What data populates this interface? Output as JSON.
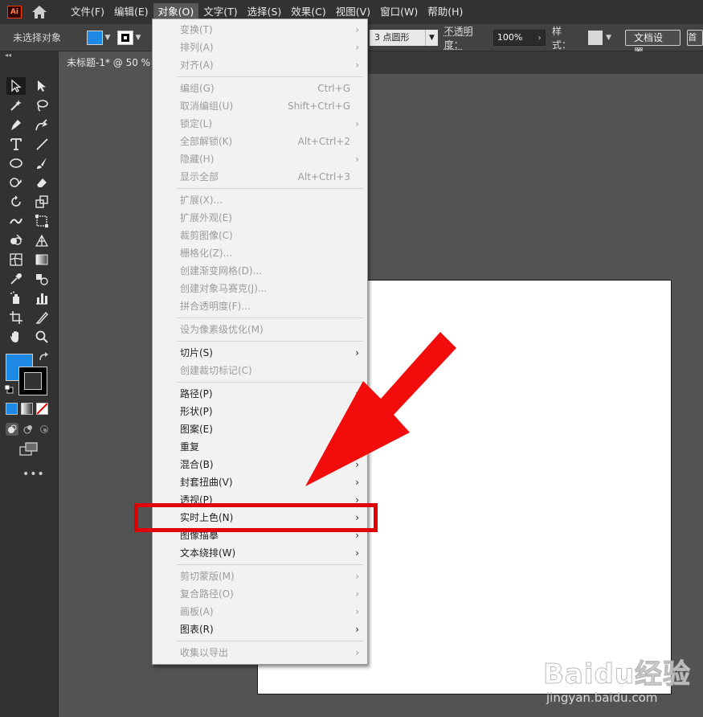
{
  "app": {
    "logo_text": "Ai"
  },
  "menubar": {
    "items": [
      {
        "label": "文件(F)"
      },
      {
        "label": "编辑(E)"
      },
      {
        "label": "对象(O)",
        "active": true
      },
      {
        "label": "文字(T)"
      },
      {
        "label": "选择(S)"
      },
      {
        "label": "效果(C)"
      },
      {
        "label": "视图(V)"
      },
      {
        "label": "窗口(W)"
      },
      {
        "label": "帮助(H)"
      }
    ]
  },
  "controlbar": {
    "selection_status": "未选择对象",
    "fill_color": "#1e88e5",
    "brush_value": "3 点圆形",
    "opacity_label": "不透明度：",
    "opacity_value": "100%",
    "style_label": "样式：",
    "doc_settings_button": "文档设置",
    "prefs_button_text": "首"
  },
  "document": {
    "tab_title": "未标题-1* @ 50 %",
    "artboard_color": "#ffffff"
  },
  "object_menu": {
    "items": [
      {
        "label": "变换(T)",
        "shortcut": "",
        "submenu": true,
        "enabled": false
      },
      {
        "label": "排列(A)",
        "shortcut": "",
        "submenu": true,
        "enabled": false
      },
      {
        "label": "对齐(A)",
        "shortcut": "",
        "submenu": true,
        "enabled": false
      },
      {
        "label": "编组(G)",
        "shortcut": "Ctrl+G",
        "submenu": false,
        "enabled": false
      },
      {
        "label": "取消编组(U)",
        "shortcut": "Shift+Ctrl+G",
        "submenu": false,
        "enabled": false
      },
      {
        "label": "锁定(L)",
        "shortcut": "",
        "submenu": true,
        "enabled": false
      },
      {
        "label": "全部解锁(K)",
        "shortcut": "Alt+Ctrl+2",
        "submenu": false,
        "enabled": false
      },
      {
        "label": "隐藏(H)",
        "shortcut": "",
        "submenu": true,
        "enabled": false
      },
      {
        "label": "显示全部",
        "shortcut": "Alt+Ctrl+3",
        "submenu": false,
        "enabled": false
      },
      {
        "label": "扩展(X)...",
        "shortcut": "",
        "submenu": false,
        "enabled": false
      },
      {
        "label": "扩展外观(E)",
        "shortcut": "",
        "submenu": false,
        "enabled": false
      },
      {
        "label": "裁剪图像(C)",
        "shortcut": "",
        "submenu": false,
        "enabled": false
      },
      {
        "label": "栅格化(Z)...",
        "shortcut": "",
        "submenu": false,
        "enabled": false
      },
      {
        "label": "创建渐变网格(D)...",
        "shortcut": "",
        "submenu": false,
        "enabled": false
      },
      {
        "label": "创建对象马赛克(J)...",
        "shortcut": "",
        "submenu": false,
        "enabled": false
      },
      {
        "label": "拼合透明度(F)...",
        "shortcut": "",
        "submenu": false,
        "enabled": false
      },
      {
        "label": "设为像素级优化(M)",
        "shortcut": "",
        "submenu": false,
        "enabled": false
      },
      {
        "label": "切片(S)",
        "shortcut": "",
        "submenu": true,
        "enabled": true
      },
      {
        "label": "创建裁切标记(C)",
        "shortcut": "",
        "submenu": false,
        "enabled": false
      },
      {
        "label": "路径(P)",
        "shortcut": "",
        "submenu": true,
        "enabled": true
      },
      {
        "label": "形状(P)",
        "shortcut": "",
        "submenu": true,
        "enabled": true
      },
      {
        "label": "图案(E)",
        "shortcut": "",
        "submenu": true,
        "enabled": true
      },
      {
        "label": "重复",
        "shortcut": "",
        "submenu": true,
        "enabled": true
      },
      {
        "label": "混合(B)",
        "shortcut": "",
        "submenu": true,
        "enabled": true
      },
      {
        "label": "封套扭曲(V)",
        "shortcut": "",
        "submenu": true,
        "enabled": true
      },
      {
        "label": "透视(P)",
        "shortcut": "",
        "submenu": true,
        "enabled": true
      },
      {
        "label": "实时上色(N)",
        "shortcut": "",
        "submenu": true,
        "enabled": true,
        "highlighted": true
      },
      {
        "label": "图像描摹",
        "shortcut": "",
        "submenu": true,
        "enabled": true
      },
      {
        "label": "文本绕排(W)",
        "shortcut": "",
        "submenu": true,
        "enabled": true
      },
      {
        "label": "剪切蒙版(M)",
        "shortcut": "",
        "submenu": true,
        "enabled": false
      },
      {
        "label": "复合路径(O)",
        "shortcut": "",
        "submenu": true,
        "enabled": false
      },
      {
        "label": "画板(A)",
        "shortcut": "",
        "submenu": true,
        "enabled": false
      },
      {
        "label": "图表(R)",
        "shortcut": "",
        "submenu": true,
        "enabled": true
      },
      {
        "label": "收集以导出",
        "shortcut": "",
        "submenu": true,
        "enabled": false
      }
    ]
  },
  "annotation": {
    "color": "#e00000",
    "target": "实时上色(N)"
  },
  "watermark": {
    "text": "Baidu经验",
    "url": "jingyan.baidu.com"
  }
}
